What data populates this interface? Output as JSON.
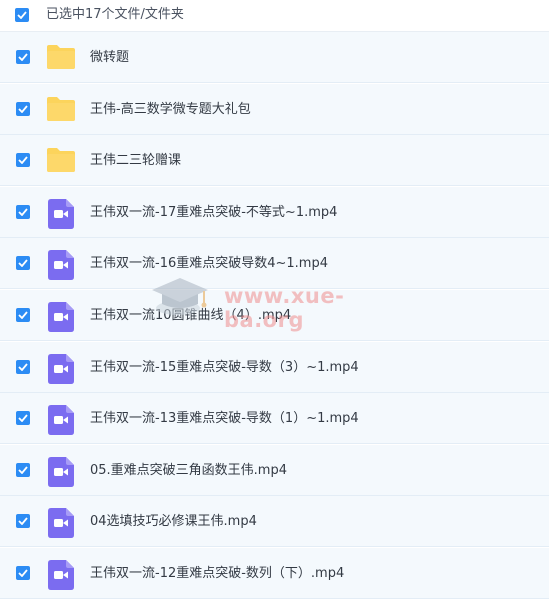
{
  "header": {
    "selected_text": "已选中17个文件/文件夹",
    "checked": true
  },
  "colors": {
    "checkbox": "#2c8cf4",
    "folder": "#fcd45c",
    "video": "#7b6cf0",
    "row_bg": "#f4f9fd"
  },
  "files": [
    {
      "name": "微转题",
      "type": "folder",
      "icon": "folder-icon",
      "checked": true
    },
    {
      "name": "王伟-高三数学微专题大礼包",
      "type": "folder",
      "icon": "folder-icon",
      "checked": true
    },
    {
      "name": "王伟二三轮赠课",
      "type": "folder",
      "icon": "folder-icon",
      "checked": true
    },
    {
      "name": "王伟双一流-17重难点突破-不等式~1.mp4",
      "type": "video",
      "icon": "video-file-icon",
      "checked": true
    },
    {
      "name": "王伟双一流-16重难点突破导数4~1.mp4",
      "type": "video",
      "icon": "video-file-icon",
      "checked": true
    },
    {
      "name": "王伟双一流10圆锥曲线（4）.mp4",
      "type": "video",
      "icon": "video-file-icon",
      "checked": true
    },
    {
      "name": "王伟双一流-15重难点突破-导数（3）~1.mp4",
      "type": "video",
      "icon": "video-file-icon",
      "checked": true
    },
    {
      "name": "王伟双一流-13重难点突破-导数（1）~1.mp4",
      "type": "video",
      "icon": "video-file-icon",
      "checked": true
    },
    {
      "name": "05.重难点突破三角函数王伟.mp4",
      "type": "video",
      "icon": "video-file-icon",
      "checked": true
    },
    {
      "name": "04选填技巧必修课王伟.mp4",
      "type": "video",
      "icon": "video-file-icon",
      "checked": true
    },
    {
      "name": "王伟双一流-12重难点突破-数列（下）.mp4",
      "type": "video",
      "icon": "video-file-icon",
      "checked": true
    }
  ],
  "watermark": {
    "text": "www.xue-ba.org"
  }
}
